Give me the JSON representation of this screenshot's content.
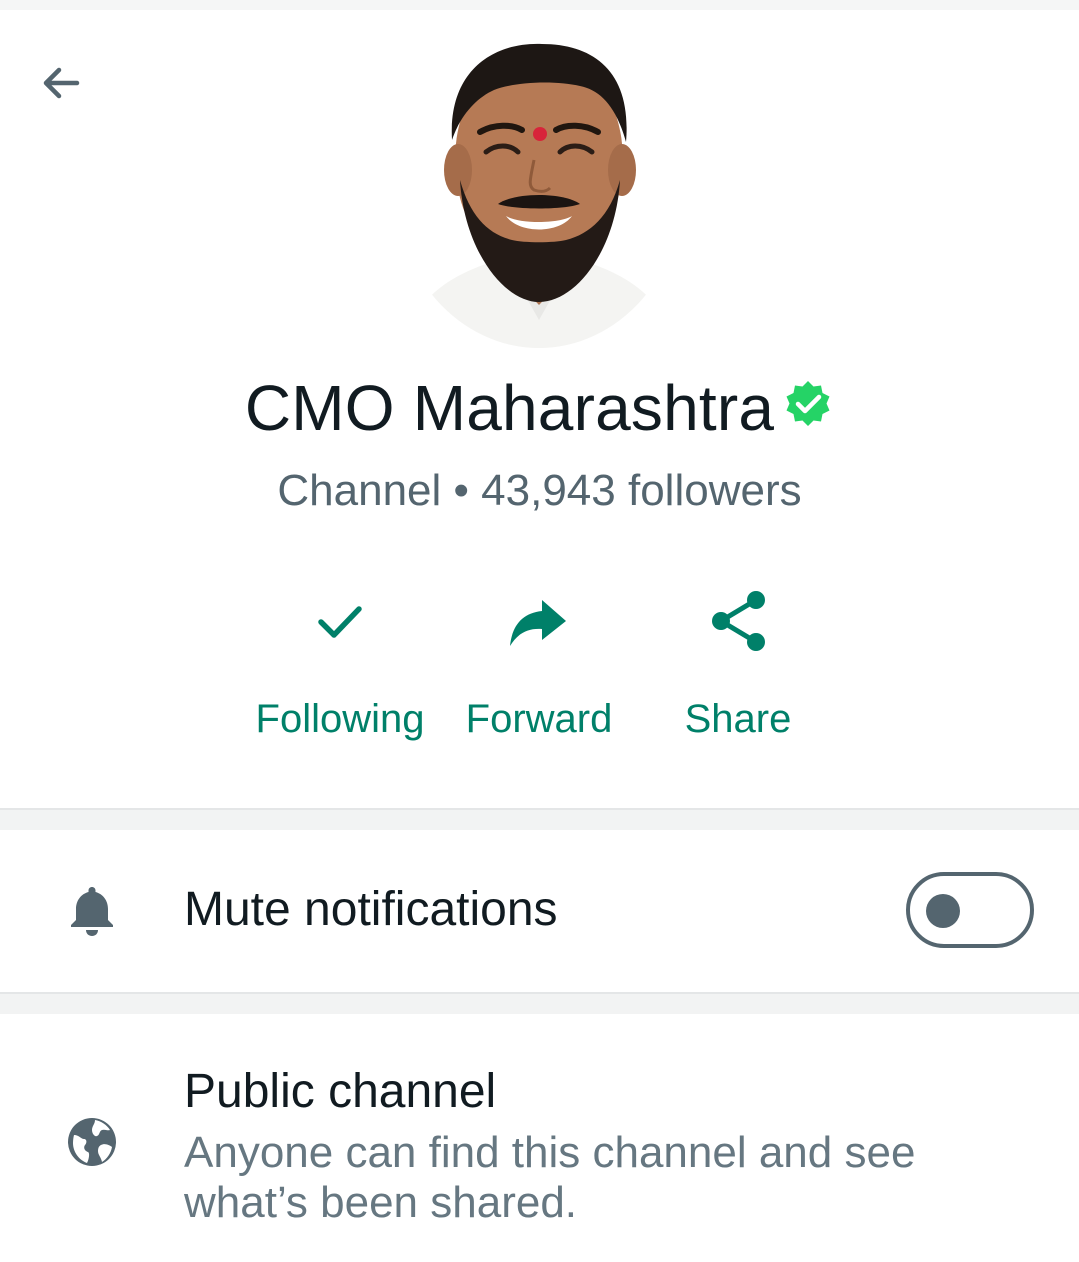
{
  "header": {
    "back_icon": "arrow-left-icon"
  },
  "profile": {
    "name": "CMO Maharashtra",
    "verified_icon": "verified-check-icon",
    "type": "Channel",
    "separator": "•",
    "followers": "43,943 followers"
  },
  "actions": [
    {
      "label": "Following",
      "icon": "check-icon"
    },
    {
      "label": "Forward",
      "icon": "forward-arrow-icon"
    },
    {
      "label": "Share",
      "icon": "share-icon"
    }
  ],
  "settings": {
    "mute": {
      "label": "Mute notifications",
      "icon": "bell-icon",
      "enabled": false
    },
    "public": {
      "title": "Public channel",
      "description": "Anyone can find this channel and see what’s been shared.",
      "icon": "globe-icon"
    }
  },
  "colors": {
    "accent": "#008069",
    "verified": "#25d366",
    "primary_text": "#111b21",
    "secondary_text": "#54656f",
    "icon_gray": "#54656f"
  }
}
